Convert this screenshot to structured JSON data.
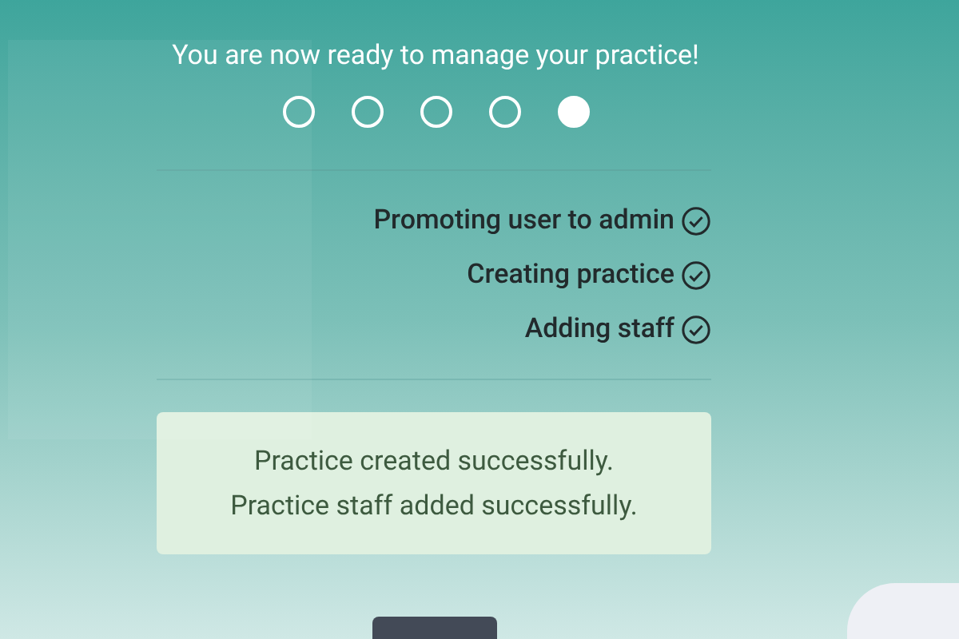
{
  "subtitle": "You are now ready to manage your practice!",
  "progress_dots": [
    {
      "selected": false
    },
    {
      "selected": false
    },
    {
      "selected": false
    },
    {
      "selected": false
    },
    {
      "selected": true
    }
  ],
  "steps": [
    {
      "label": "Promoting user to admin",
      "done": true
    },
    {
      "label": "Creating practice",
      "done": true
    },
    {
      "label": "Adding staff",
      "done": true
    }
  ],
  "alert": {
    "lines": [
      "Practice created successfully.",
      "Practice staff added successfully."
    ]
  }
}
